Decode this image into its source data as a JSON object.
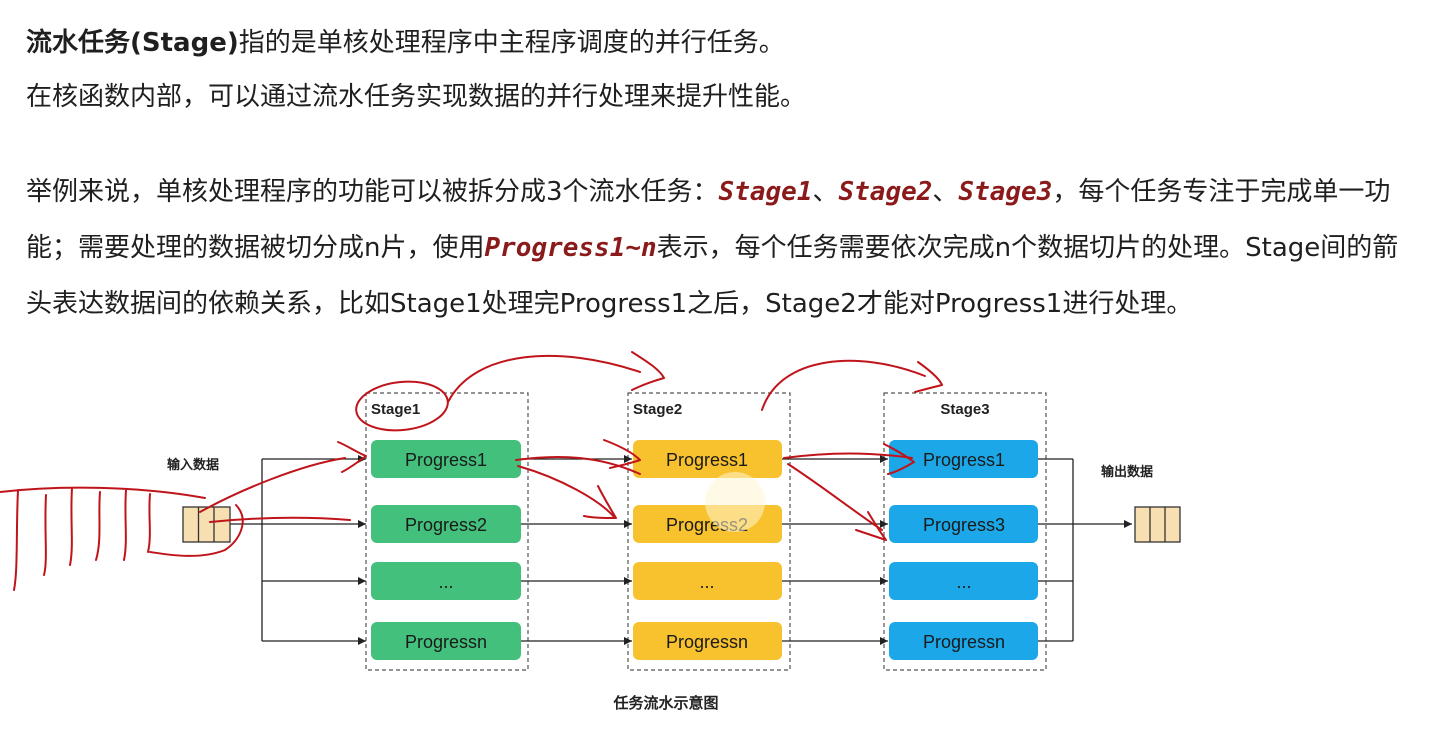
{
  "text": {
    "line1": {
      "bold": "流水任务(Stage)",
      "rest": "指的是单核处理程序中主程序调度的并行任务。"
    },
    "line2": "在核函数内部，可以通过流水任务实现数据的并行处理来提升性能。",
    "para": {
      "t1": "举例来说，单核处理程序的功能可以被拆分成3个流水任务：",
      "c1": "Stage1",
      "t2": "、",
      "c2": "Stage2",
      "t3": "、",
      "c3": "Stage3",
      "t4": "，每个任务专注于完成单一功能；需要处理的数据被切分成n片，使用",
      "c4": "Progress1~n",
      "t5": "表示，每个任务需要依次完成n个数据切片的处理。Stage间的箭头表达数据间的依赖关系，比如Stage1处理完Progress1之后，Stage2才能对Progress1进行处理。"
    }
  },
  "diagram": {
    "input_label": "输入数据",
    "output_label": "输出数据",
    "caption": "任务流水示意图",
    "stages": [
      {
        "label": "Stage1",
        "color": "#43c07c",
        "items": [
          "Progress1",
          "Progress2",
          "...",
          "Progressn"
        ]
      },
      {
        "label": "Stage2",
        "color": "#f8c22e",
        "items": [
          "Progress1",
          "Progress2",
          "...",
          "Progressn"
        ]
      },
      {
        "label": "Stage3",
        "color": "#1ca8e8",
        "items": [
          "Progress1",
          "Progress3",
          "...",
          "Progressn"
        ]
      }
    ],
    "queue_color": "#f7dfb1",
    "annotation_color": "#c0141b"
  }
}
